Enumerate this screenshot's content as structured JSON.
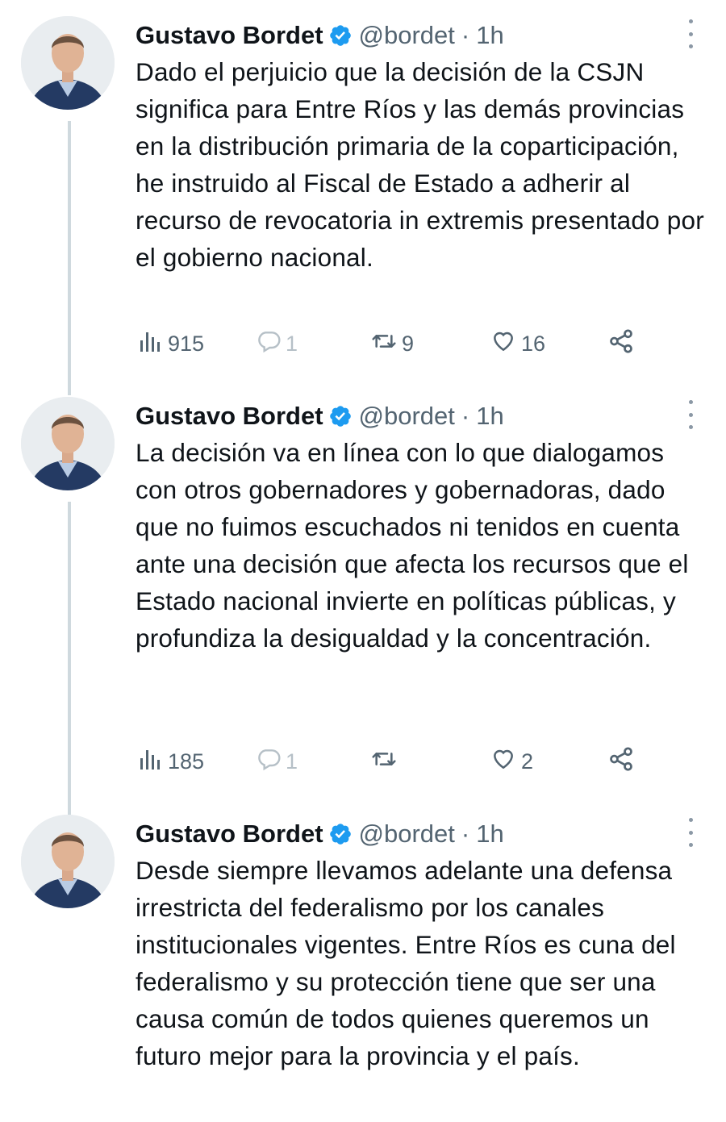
{
  "tweets": [
    {
      "name": "Gustavo Bordet",
      "handle": "@bordet",
      "separator": "·",
      "time": "1h",
      "text": "Dado el perjuicio que la decisión de la CSJN significa para Entre Ríos y las demás provincias en la distribución primaria de la coparticipación, he instruido al Fiscal de Estado a adherir al recurso de revocatoria in extremis presentado por el gobierno nacional.",
      "views": "915",
      "replies": "1",
      "retweets": "9",
      "likes": "16"
    },
    {
      "name": "Gustavo Bordet",
      "handle": "@bordet",
      "separator": "·",
      "time": "1h",
      "text": "La decisión va en línea con lo que dialogamos con otros gobernadores y gobernadoras, dado que no fuimos escuchados ni tenidos en cuenta ante una decisión que afecta los recursos que el Estado nacional invierte en políticas públicas, y profundiza la desigualdad y la concentración.",
      "views": "185",
      "replies": "1",
      "retweets": "",
      "likes": "2"
    },
    {
      "name": "Gustavo Bordet",
      "handle": "@bordet",
      "separator": "·",
      "time": "1h",
      "text": "Desde siempre llevamos adelante una defensa irrestricta del federalismo por los canales institucionales vigentes. Entre Ríos es cuna del federalismo y su protección tiene que ser una causa común de todos quienes queremos un futuro mejor para la provincia y el país."
    }
  ],
  "icons": {
    "verified": "verified-badge-icon",
    "views": "views-bar-chart-icon",
    "reply": "reply-bubble-icon",
    "retweet": "retweet-arrows-icon",
    "like": "heart-icon",
    "share": "share-icon",
    "more": "more-dots-icon"
  },
  "colors": {
    "verified": "#1d9bf0",
    "text": "#0f1419",
    "secondary": "#536471",
    "thread_line": "#cfd9de"
  }
}
